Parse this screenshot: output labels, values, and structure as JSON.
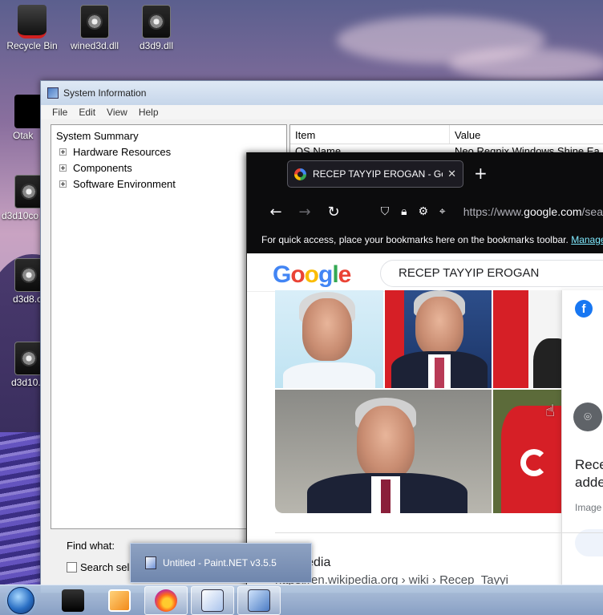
{
  "desktop": {
    "icons": [
      {
        "label": "Recycle Bin"
      },
      {
        "label": "wined3d.dll"
      },
      {
        "label": "d3d9.dll"
      },
      {
        "label": "Otak"
      },
      {
        "label": "d3d10co"
      },
      {
        "label": "d3d8.c"
      },
      {
        "label": "d3d10."
      }
    ]
  },
  "sysinfo": {
    "title": "System Information",
    "menu": [
      "File",
      "Edit",
      "View",
      "Help"
    ],
    "tree": {
      "root": "System Summary",
      "children": [
        "Hardware Resources",
        "Components",
        "Software Environment"
      ]
    },
    "columns": [
      "Item",
      "Value"
    ],
    "rows": [
      {
        "item": "OS Name",
        "value": "Neo Regnix Windows Shine Ea"
      }
    ],
    "find_label": "Find what:",
    "search_selected_label": "Search sele"
  },
  "firefox": {
    "tab_title": "RECEP TAYYIP EROGAN - Goog",
    "new_tab": "+",
    "url_prefix": "https://www.",
    "url_domain": "google.com",
    "url_suffix": "/sea",
    "bookmarks_text": "For quick access, place your bookmarks here on the bookmarks toolbar.",
    "bookmarks_link": "Manage"
  },
  "google": {
    "logo_letters": [
      "G",
      "o",
      "o",
      "g",
      "l",
      "e"
    ],
    "search_query": "RECEP TAYYIP EROGAN",
    "side_title_1": "Rece",
    "side_title_2": "adde",
    "side_label": "Image",
    "fb_letter": "f",
    "wiki_site": "Wikipedia",
    "wiki_crumb": "https://en.wikipedia.org › wiki › Recep_Tayyi"
  },
  "taskbar": {
    "tooltip": "Untitled - Paint.NET v3.5.5"
  },
  "colors": {
    "google_blue": "#4285f4",
    "google_red": "#ea4335",
    "google_yellow": "#fbbc05",
    "google_green": "#34a853",
    "firefox_chrome": "#0c0c0d",
    "link_cyan": "#80ebff"
  }
}
